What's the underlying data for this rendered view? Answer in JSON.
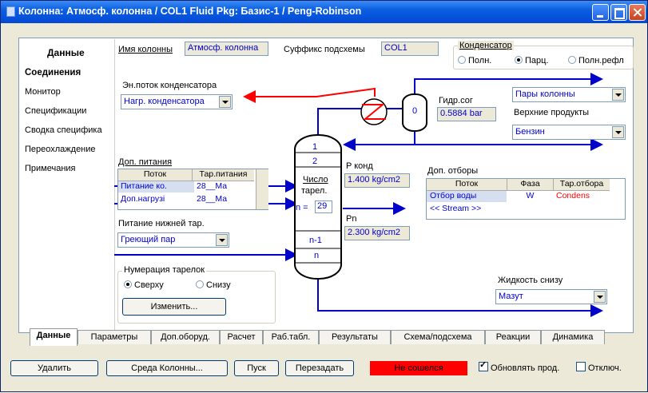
{
  "window": {
    "title": "Колонна: Атмосф. колонна / COL1  Fluid Pkg: Базис-1 / Peng-Robinson"
  },
  "left_nav": {
    "header": "Данные",
    "items": [
      "Соединения",
      "Монитор",
      "Спецификации",
      "Сводка специфика",
      "Переохлаждение",
      "Примечания"
    ]
  },
  "column_name": {
    "label": "Имя колонны",
    "value": "Атмосф. колонна"
  },
  "subflowsheet_suffix": {
    "label": "Суффикс подсхемы",
    "value": "COL1"
  },
  "condenser": {
    "group_label": "Конденсатор",
    "options": [
      "Полн.",
      "Парц.",
      "Полн.рефл"
    ],
    "selected_index": 1
  },
  "condenser_energy": {
    "label": "Эн.поток конденсатора",
    "value": "Нагр. конденсатора"
  },
  "vapor_outlet": {
    "value": "Пары колонны"
  },
  "top_products": {
    "label": "Верхние продукты",
    "value": "Бензин"
  },
  "reboiler": {
    "label": "Гидр.сог",
    "value": "0.5884 bar",
    "drum_label": "0"
  },
  "feeds": {
    "label": "Доп. питания",
    "headers": [
      "Поток",
      "Тар.питания"
    ],
    "rows": [
      [
        "Питание ко.",
        "28__Ма"
      ],
      [
        "Доп.нагрузі",
        "28__Ма"
      ]
    ]
  },
  "column_diagram": {
    "stage_top": "1",
    "stage_second": "2",
    "stage_count_label_1": "Число",
    "stage_count_label_2": "тарел.",
    "n_prefix": "n =",
    "n_value": "29",
    "stage_n_minus_1": "n-1",
    "stage_n": "n"
  },
  "p_cond": {
    "label": "P конд",
    "value": "1.400 kg/cm2"
  },
  "p_bottom": {
    "label": "Pn",
    "value": "2.300 kg/cm2"
  },
  "side_draws": {
    "label": "Доп. отборы",
    "headers": [
      "Поток",
      "Фаза",
      "Тар.отбора"
    ],
    "rows": [
      [
        "Отбор воды",
        "W",
        "Condens"
      ],
      [
        "<< Stream >>",
        "",
        ""
      ]
    ]
  },
  "bottom_feed": {
    "label": "Питание нижней тар.",
    "value": "Греющий пар"
  },
  "stage_numbering": {
    "group_label": "Нумерация тарелок",
    "options": [
      "Сверху",
      "Снизу"
    ],
    "selected_index": 0,
    "change_button": "Изменить..."
  },
  "bottoms_liquid": {
    "label": "Жидкость снизу",
    "value": "Мазут"
  },
  "tabs": [
    "Данные",
    "Параметры",
    "Доп.оборуд.",
    "Расчет",
    "Раб.табл.",
    "Результаты",
    "Схема/подсхема",
    "Реакции",
    "Динамика"
  ],
  "active_tab": 0,
  "bottom_bar": {
    "delete": "Удалить",
    "environment": "Среда Колонны...",
    "run": "Пуск",
    "reset": "Перезадать",
    "status": "Не сошелся",
    "update_outlets": "Обновлять прод.",
    "update_checked": true,
    "ignore": "Отключ.",
    "ignore_checked": false
  },
  "colors": {
    "title_bar": "#0a5fe0",
    "field_text": "#0000cc",
    "energy_stream": "#ff0000",
    "material_stream": "#0000cc",
    "status_bg": "#ff0000"
  }
}
